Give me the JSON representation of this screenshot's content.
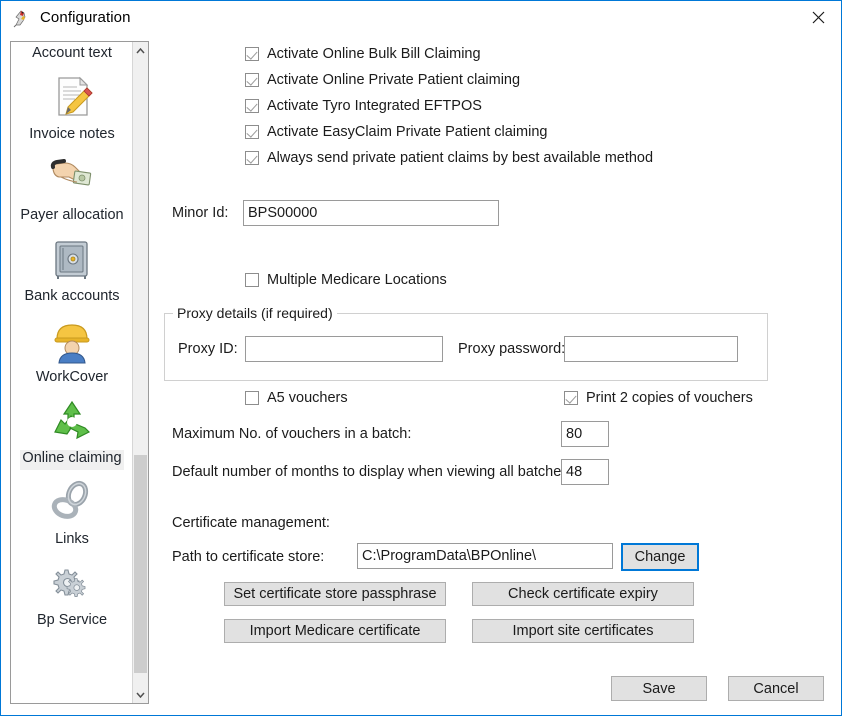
{
  "window": {
    "title": "Configuration",
    "app_icon": "bird-icon",
    "close_icon": "close-icon",
    "accent_color": "#0078d7"
  },
  "sidebar": {
    "scroll_up_icon": "chevron-up-icon",
    "scroll_down_icon": "chevron-down-icon",
    "items": [
      {
        "label": "Account text",
        "icon": "document-text-icon",
        "selected": false,
        "icon_visible": false
      },
      {
        "label": "Invoice notes",
        "icon": "document-pencil-icon",
        "selected": false,
        "icon_visible": true
      },
      {
        "label": "Payer allocation",
        "icon": "hand-money-icon",
        "selected": false,
        "icon_visible": true
      },
      {
        "label": "Bank accounts",
        "icon": "safe-icon",
        "selected": false,
        "icon_visible": true
      },
      {
        "label": "WorkCover",
        "icon": "worker-helmet-icon",
        "selected": false,
        "icon_visible": true
      },
      {
        "label": "Online claiming",
        "icon": "recycle-arrows-icon",
        "selected": true,
        "icon_visible": true
      },
      {
        "label": "Links",
        "icon": "chain-links-icon",
        "selected": false,
        "icon_visible": true
      },
      {
        "label": "Bp Service",
        "icon": "gears-icon",
        "selected": false,
        "icon_visible": true
      }
    ]
  },
  "main": {
    "activation_checkboxes": [
      {
        "label": "Activate Online Bulk Bill Claiming",
        "checked": true
      },
      {
        "label": "Activate Online Private Patient claiming",
        "checked": true
      },
      {
        "label": "Activate Tyro Integrated EFTPOS",
        "checked": true
      },
      {
        "label": "Activate EasyClaim Private Patient claiming",
        "checked": true
      },
      {
        "label": "Always send private patient claims by best available method",
        "checked": true
      }
    ],
    "minor_id": {
      "label": "Minor Id:",
      "value": "BPS00000",
      "placeholder": ""
    },
    "multiple_locations": {
      "label": "Multiple Medicare Locations",
      "checked": false
    },
    "proxy": {
      "group_title": "Proxy details (if required)",
      "id_label": "Proxy ID:",
      "id_value": "",
      "password_label": "Proxy password:",
      "password_value": ""
    },
    "vouchers": {
      "a5_label": "A5 vouchers",
      "a5_checked": false,
      "print2_label": "Print 2 copies of vouchers",
      "print2_checked": true,
      "max_label": "Maximum No. of vouchers in a batch:",
      "max_value": "80",
      "months_label": "Default number of months to display when viewing all batches:",
      "months_value": "48"
    },
    "certificates": {
      "section_label": "Certificate management:",
      "path_label": "Path to certificate store:",
      "path_value": "C:\\ProgramData\\BPOnline\\",
      "change_button": "Change",
      "set_passphrase_button": "Set certificate store passphrase",
      "check_expiry_button": "Check certificate expiry",
      "import_medicare_button": "Import Medicare certificate",
      "import_site_button": "Import site certificates"
    }
  },
  "footer": {
    "save_button": "Save",
    "cancel_button": "Cancel"
  }
}
